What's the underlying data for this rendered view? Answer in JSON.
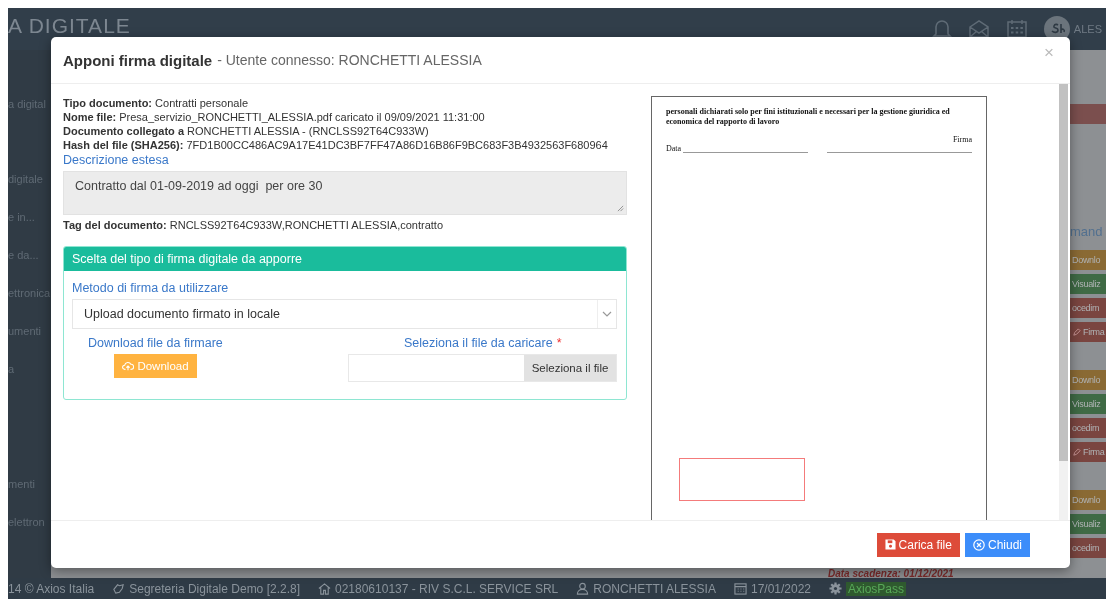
{
  "app": {
    "logo": "A DIGITALE",
    "user_short": "ALES",
    "sidebar": [
      "a digital",
      "digitale",
      "e in...",
      "e da...",
      "ettronica",
      "umenti",
      "a",
      "menti",
      "elettron"
    ],
    "right_column": {
      "link": "mand",
      "groups": [
        [
          {
            "label": "Downlo",
            "color": "#8a6a34"
          },
          {
            "label": "Visualiz",
            "color": "#3f6a45"
          },
          {
            "label": "ocedim",
            "color": "#7a4540"
          },
          {
            "label": "Firma",
            "color": "#7a4540",
            "kind": "sign"
          }
        ],
        [
          {
            "label": "Downlo",
            "color": "#8a6a34"
          },
          {
            "label": "Visualiz",
            "color": "#3f6a45"
          },
          {
            "label": "ocedim",
            "color": "#7a4540"
          },
          {
            "label": "Firma",
            "color": "#7a4540",
            "kind": "sign"
          }
        ],
        [
          {
            "label": "Downlo",
            "color": "#8a6a34"
          },
          {
            "label": "Visualiz",
            "color": "#3f6a45"
          },
          {
            "label": "ocedim",
            "color": "#7a4540"
          }
        ]
      ]
    },
    "due_date": "Data scadenza: 01/12/2021",
    "status_bar": [
      {
        "kind": "text",
        "text": "14 © Axios Italia"
      },
      {
        "kind": "app",
        "text": "Segreteria Digitale Demo [2.2.8]"
      },
      {
        "kind": "home",
        "text": "02180610137 - RIV S.C.L. SERVICE SRL"
      },
      {
        "kind": "user",
        "text": "RONCHETTI ALESSIA"
      },
      {
        "kind": "date",
        "text": "17/01/2022"
      },
      {
        "kind": "pass",
        "text": "AxiosPass"
      }
    ]
  },
  "modal": {
    "title": "Apponi firma digitale",
    "subtitle": "- Utente connesso: RONCHETTI ALESSIA",
    "close": "×",
    "info": [
      {
        "label": "Tipo documento:",
        "value": "Contratti personale"
      },
      {
        "label": "Nome file:",
        "value": "Presa_servizio_RONCHETTI_ALESSIA.pdf caricato il 09/09/2021 11:31:00"
      },
      {
        "label": "Documento collegato a",
        "value": "RONCHETTI ALESSIA - (RNCLSS92T64C933W)"
      },
      {
        "label": "Hash del file (SHA256):",
        "value": "7FD1B00CC486AC9A17E41DC3BF7FF47A86D16B86F9BC683F3B4932563F680964"
      }
    ],
    "description_link": "Descrizione estesa",
    "description": "Contratto dal 01-09-2019 ad oggi  per ore 30",
    "tags": {
      "label": "Tag del documento:",
      "value": "RNCLSS92T64C933W,RONCHETTI ALESSIA,contratto"
    },
    "panel": {
      "title": "Scelta del tipo di firma digitale da apporre",
      "method_label": "Metodo di firma da utilizzare",
      "method_value": "Upload documento firmato in locale",
      "download_label": "Download file da firmare",
      "download_button": "Download",
      "upload_label": "Seleziona il file da caricare",
      "required_mark": "*",
      "upload_button": "Seleziona il file"
    },
    "preview": {
      "heading": "personali dichiarati solo per fini istituzionali e necessari per la gestione giuridica ed economica del rapporto di lavoro",
      "date_label": "Data",
      "sign_label": "Firma"
    },
    "buttons": [
      {
        "kind": "save",
        "label": "Carica file"
      },
      {
        "kind": "close",
        "label": "Chiudi"
      }
    ]
  }
}
